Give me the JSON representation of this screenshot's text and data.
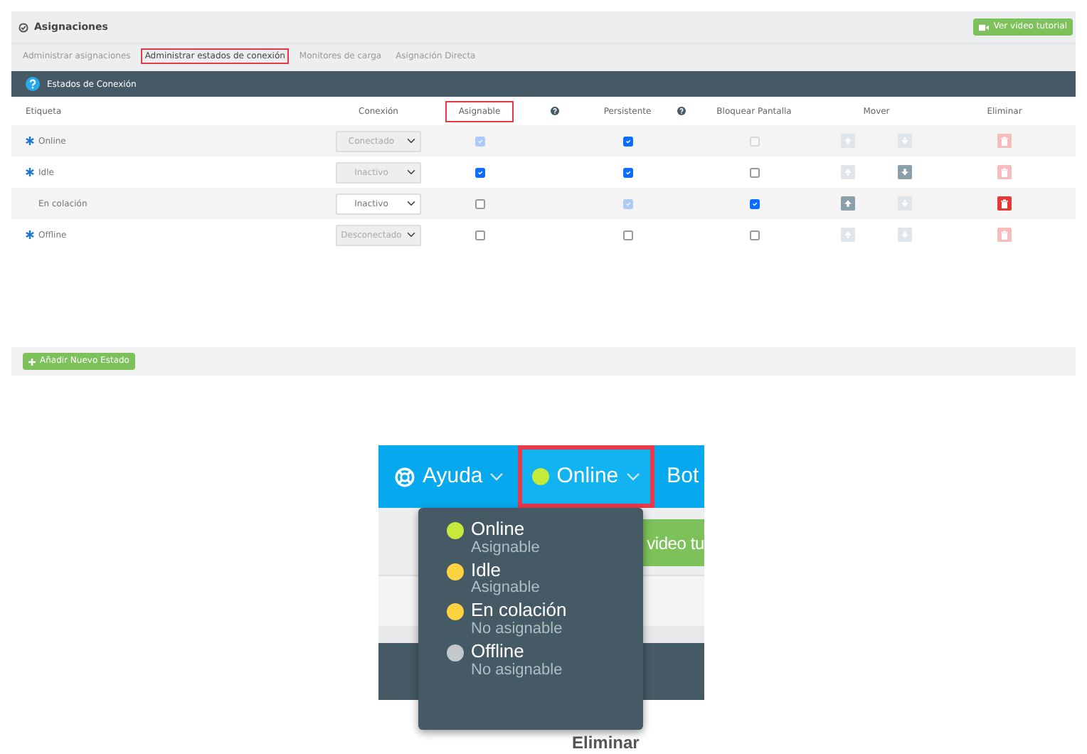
{
  "top_screen": {
    "title": "Asignaciones",
    "tutorial_button": "Ver video tutorial",
    "tabs": [
      {
        "label": "Administrar asignaciones",
        "selected": false,
        "highlighted": false
      },
      {
        "label": "Administrar estados de conexión",
        "selected": true,
        "highlighted": true
      },
      {
        "label": "Monitores de carga",
        "selected": false,
        "highlighted": false
      },
      {
        "label": "Asignación Directa",
        "selected": false,
        "highlighted": false
      }
    ],
    "panel_title": "Estados de Conexión",
    "columns": [
      {
        "kind": "text",
        "label": "Etiqueta",
        "highlighted": false
      },
      {
        "kind": "text",
        "label": "Conexión",
        "highlighted": false
      },
      {
        "kind": "text",
        "label": "Asignable",
        "highlighted": true
      },
      {
        "kind": "help"
      },
      {
        "kind": "text",
        "label": "Persistente",
        "highlighted": false
      },
      {
        "kind": "help"
      },
      {
        "kind": "text",
        "label": "Bloquear Pantalla",
        "highlighted": false
      },
      {
        "kind": "text",
        "label": "Mover",
        "highlighted": false
      },
      {
        "kind": "text",
        "label": "Eliminar",
        "highlighted": false
      }
    ],
    "rows": [
      {
        "label": "Online",
        "required": true,
        "connection": {
          "value": "Conectado",
          "disabled": true
        },
        "assignable": {
          "checked": true,
          "disabled": true
        },
        "persistent": {
          "checked": true,
          "disabled": false
        },
        "lock_screen": {
          "checked": false,
          "disabled": true
        },
        "move_up": {
          "disabled": true
        },
        "move_down": {
          "disabled": true
        },
        "delete": {
          "disabled": true
        }
      },
      {
        "label": "Idle",
        "required": true,
        "connection": {
          "value": "Inactivo",
          "disabled": true
        },
        "assignable": {
          "checked": true,
          "disabled": false
        },
        "persistent": {
          "checked": true,
          "disabled": false
        },
        "lock_screen": {
          "checked": false,
          "disabled": false
        },
        "move_up": {
          "disabled": true
        },
        "move_down": {
          "disabled": false
        },
        "delete": {
          "disabled": true
        }
      },
      {
        "label": "En colación",
        "required": false,
        "connection": {
          "value": "Inactivo",
          "disabled": false
        },
        "assignable": {
          "checked": false,
          "disabled": false
        },
        "persistent": {
          "checked": true,
          "disabled": true
        },
        "lock_screen": {
          "checked": true,
          "disabled": false
        },
        "move_up": {
          "disabled": false
        },
        "move_down": {
          "disabled": true
        },
        "delete": {
          "disabled": false
        }
      },
      {
        "label": "Offline",
        "required": true,
        "connection": {
          "value": "Desconectado",
          "disabled": true
        },
        "assignable": {
          "checked": false,
          "disabled": false
        },
        "persistent": {
          "checked": false,
          "disabled": false
        },
        "lock_screen": {
          "checked": false,
          "disabled": false
        },
        "move_up": {
          "disabled": true
        },
        "move_down": {
          "disabled": true
        },
        "delete": {
          "disabled": true
        }
      }
    ],
    "add_button": "Añadir Nuevo Estado"
  },
  "bottom_screen": {
    "nav": [
      {
        "kind": "help",
        "label": "Ayuda",
        "dropdown": true,
        "highlighted": false
      },
      {
        "kind": "status",
        "label": "Online",
        "dropdown": true,
        "highlighted": true,
        "color": "#c6ea3b"
      },
      {
        "kind": "text",
        "label": "Bot",
        "dropdown": false,
        "highlighted": false
      }
    ],
    "tutorial_button": "video tu",
    "column_label": "Eliminar",
    "status_menu": [
      {
        "label": "Online",
        "sub": "Asignable",
        "color": "#c6ea3b"
      },
      {
        "label": "Idle",
        "sub": "Asignable",
        "color": "#fdd340"
      },
      {
        "label": "En colación",
        "sub": "No asignable",
        "color": "#fdd340"
      },
      {
        "label": "Offline",
        "sub": "No asignable",
        "color": "#c4c8ca"
      }
    ]
  }
}
